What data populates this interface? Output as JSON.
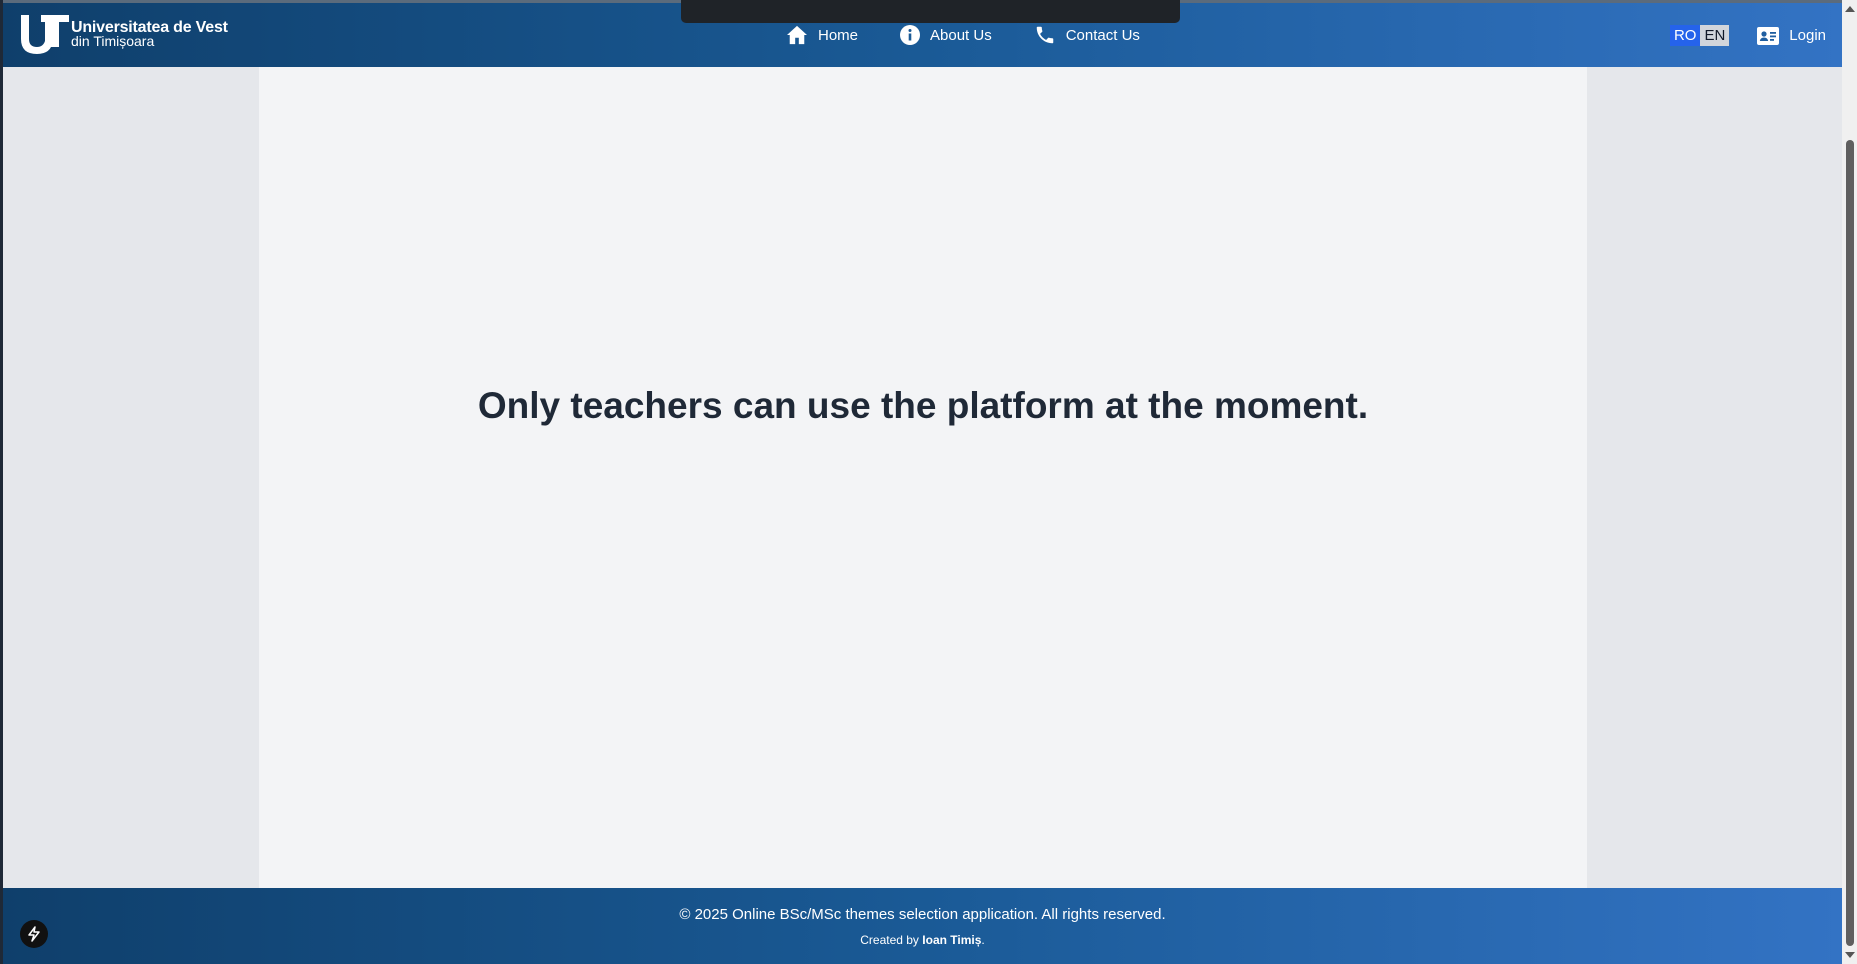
{
  "brand": {
    "line1": "Universitatea de Vest",
    "line2": "din Timișoara",
    "logo_icon": "uvt-logo-icon"
  },
  "nav": {
    "items": [
      {
        "label": "Home",
        "icon": "home-icon"
      },
      {
        "label": "About Us",
        "icon": "info-icon"
      },
      {
        "label": "Contact Us",
        "icon": "phone-icon"
      }
    ]
  },
  "language": {
    "options": [
      "RO",
      "EN"
    ],
    "selected": "RO"
  },
  "auth": {
    "login_label": "Login",
    "icon": "id-card-icon"
  },
  "main": {
    "message": "Only teachers can use the platform at the moment."
  },
  "footer": {
    "copyright": "© 2025 Online BSc/MSc themes selection application. All rights reserved.",
    "created_prefix": "Created by ",
    "author": "Ioan Timiș",
    "created_suffix": "."
  },
  "colors": {
    "navbar_start": "#0f3f6b",
    "navbar_end": "#3373c4",
    "content_bg": "#f3f4f6",
    "side_bg": "#e5e7eb",
    "lang_active": "#2563eb"
  }
}
